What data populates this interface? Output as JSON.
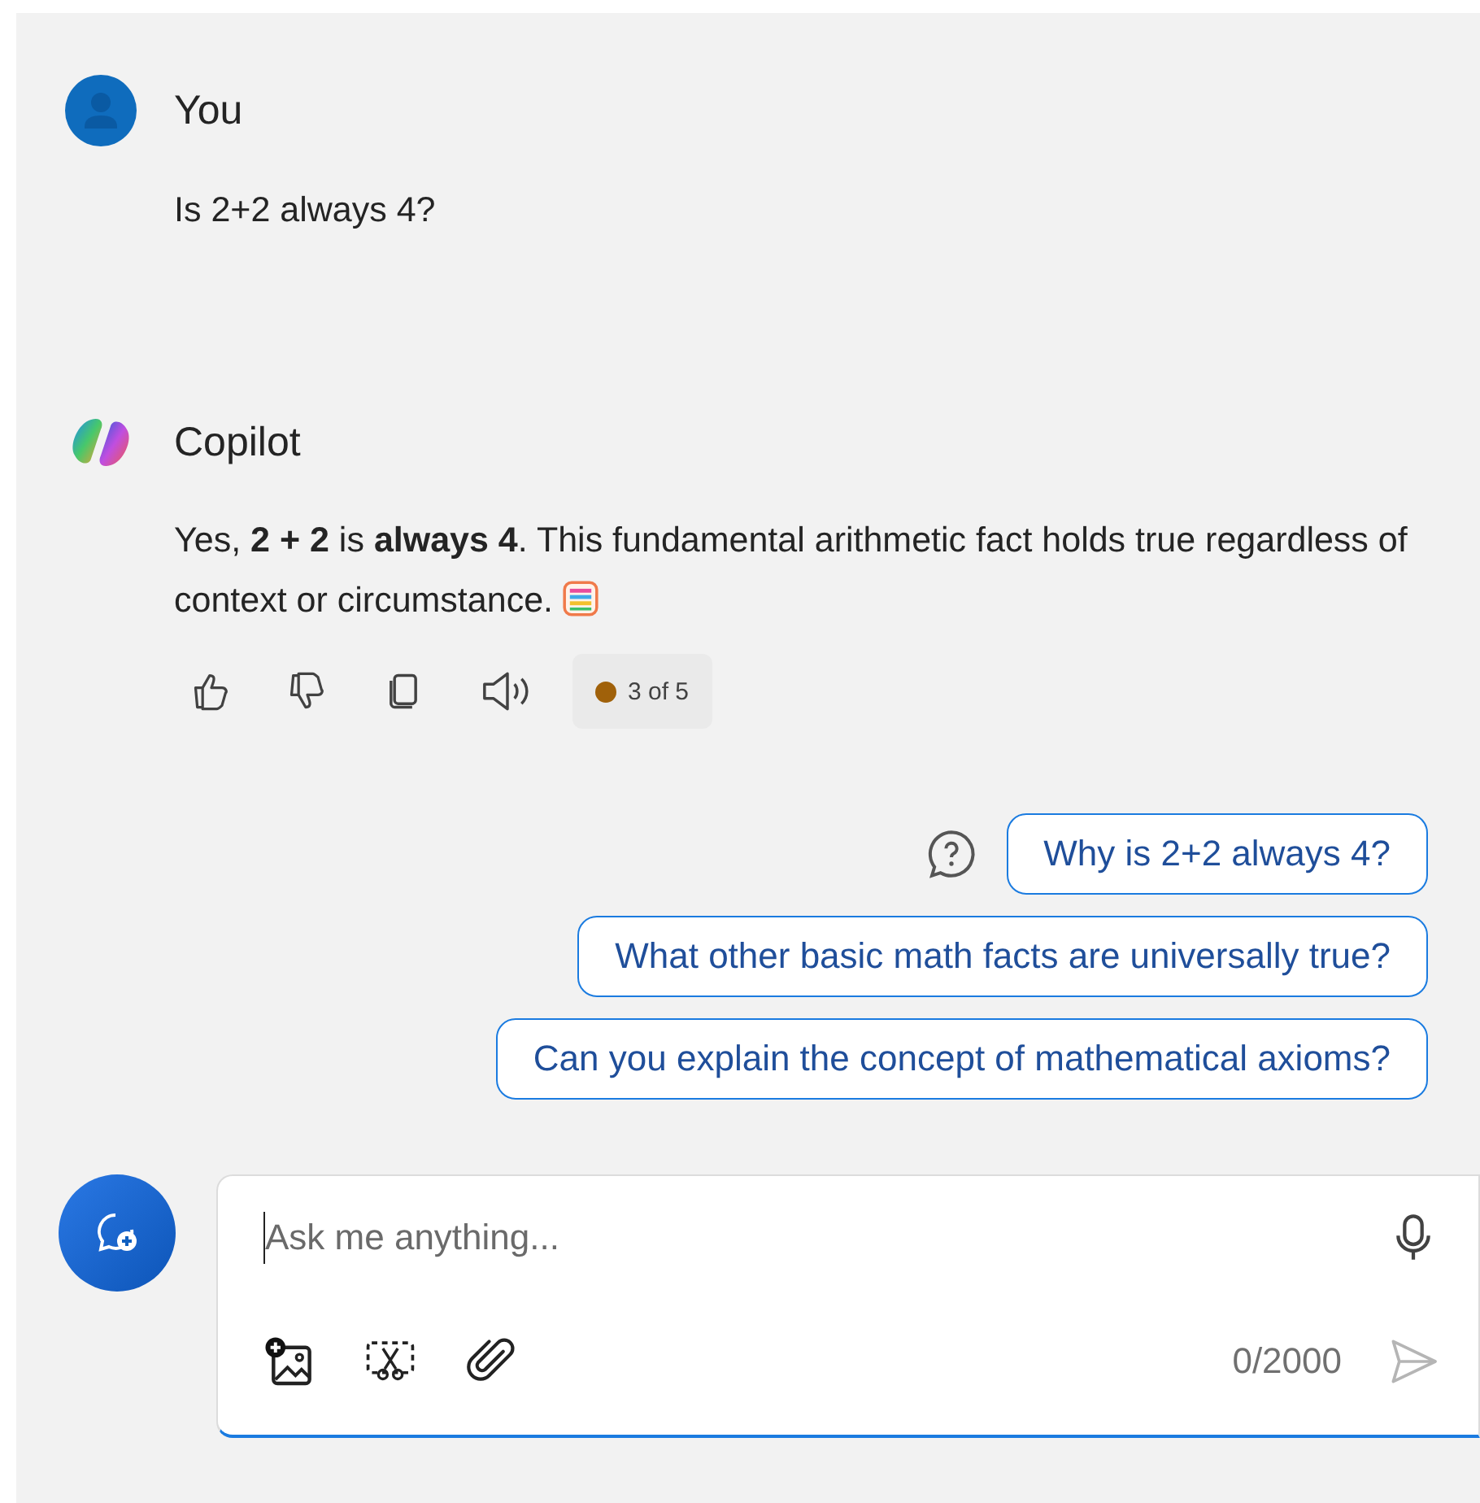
{
  "messages": [
    {
      "kind": "user",
      "author": "You",
      "text": "Is 2+2 always 4?"
    },
    {
      "kind": "assistant",
      "author": "Copilot",
      "text": "Yes, **2 + 2** is **always 4**. This fundamental arithmetic fact holds true regardless of context or circumstance.",
      "citation": true,
      "response_counter": {
        "label": "3 of 5",
        "color": "#a0610a"
      }
    }
  ],
  "suggestions": [
    "Why is 2+2 always 4?",
    "What other basic math facts are universally true?",
    "Can you explain the concept of mathematical axioms?"
  ],
  "composer": {
    "placeholder": "Ask me anything...",
    "char_count": "0/2000"
  }
}
